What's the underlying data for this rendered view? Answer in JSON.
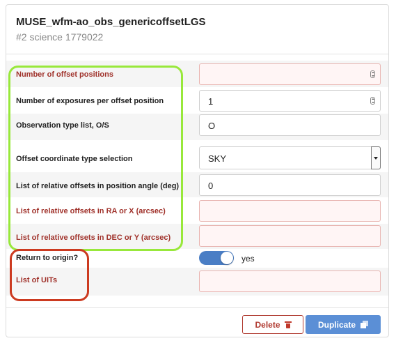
{
  "template": {
    "title": "MUSE_wfm-ao_obs_genericoffsetLGS",
    "subtitle": "#2 science 1779022"
  },
  "params": [
    {
      "label": "Number of offset positions",
      "value": "",
      "required": true,
      "input": "number"
    },
    {
      "label": "Number of exposures per offset position",
      "value": "1",
      "required": false,
      "input": "number"
    },
    {
      "label": "Observation type list, O/S",
      "value": "O",
      "required": false,
      "input": "text"
    },
    {
      "label": "Offset coordinate type selection",
      "value": "SKY",
      "required": false,
      "input": "select"
    },
    {
      "label": "List of relative offsets in position angle (deg)",
      "value": "0",
      "required": false,
      "input": "text"
    },
    {
      "label": "List of relative offsets in RA or X (arcsec)",
      "value": "",
      "required": true,
      "input": "text"
    },
    {
      "label": "List of relative offsets in DEC or Y (arcsec)",
      "value": "",
      "required": true,
      "input": "text"
    },
    {
      "label": "Return to origin?",
      "value": "yes",
      "required": false,
      "input": "toggle",
      "toggle_on": true
    },
    {
      "label": "List of UITs",
      "value": "",
      "required": true,
      "input": "text"
    }
  ],
  "buttons": {
    "delete_label": "Delete",
    "duplicate_label": "Duplicate"
  },
  "icons": {
    "delete": "trash-icon",
    "duplicate": "copy-icon"
  },
  "colors": {
    "required_label": "#a0322b",
    "primary_button": "#5b8fd6",
    "danger": "#b03a30",
    "toggle_on": "#4a7ec5",
    "highlight_green": "#98e83b",
    "highlight_red": "#cc3a20"
  }
}
